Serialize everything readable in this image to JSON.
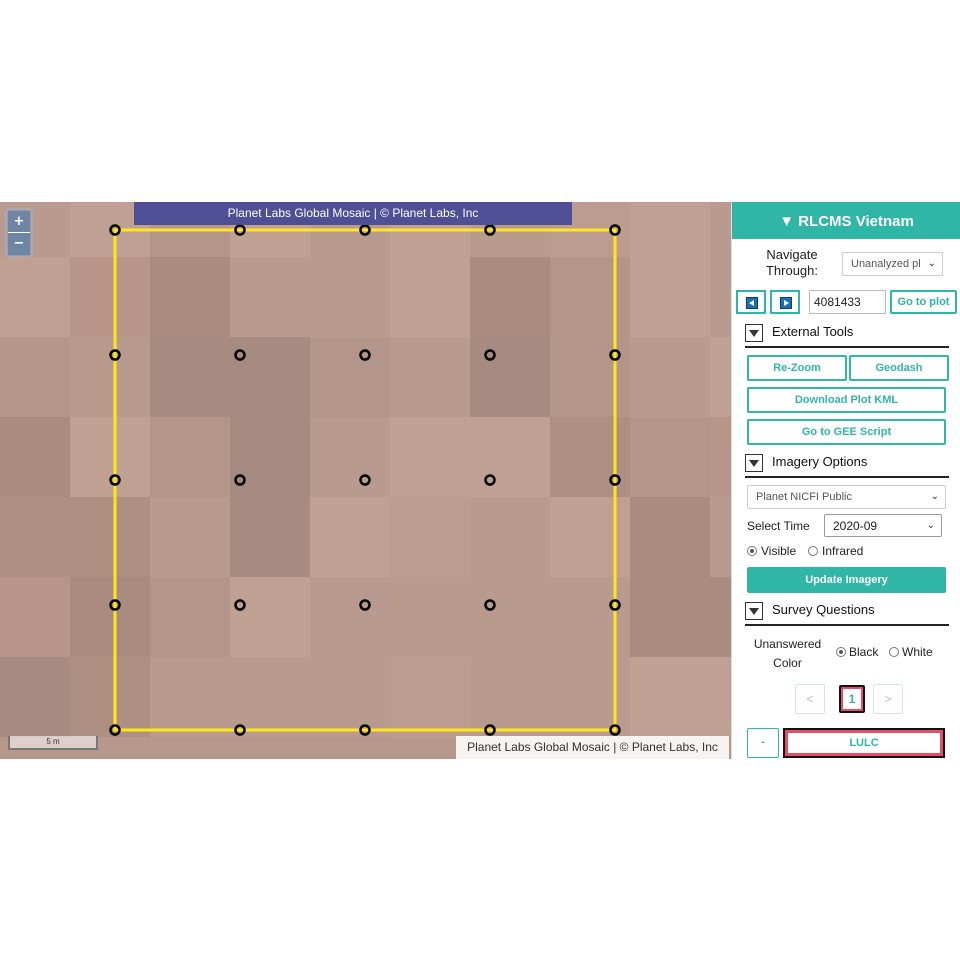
{
  "map": {
    "imagery_banner": "Planet Labs Global Mosaic | © Planet Labs, Inc",
    "attribution": "Planet Labs Global Mosaic | © Planet Labs, Inc",
    "zoom_in": "+",
    "zoom_out": "−",
    "scale_label": "5 m",
    "plot_boundary_color": "#ffe619",
    "sample_point_grid": {
      "rows": 5,
      "cols": 5
    }
  },
  "sidebar": {
    "project_title": "▼ RLCMS Vietnam",
    "navigate_label": "Navigate Through:",
    "navigate_select": "Unanalyzed pl",
    "plot_id": "4081433",
    "go_to_plot": "Go to plot",
    "external_tools": {
      "title": "External Tools",
      "rezoom": "Re-Zoom",
      "geodash": "Geodash",
      "download_kml": "Download Plot KML",
      "gee_script": "Go to GEE Script"
    },
    "imagery_options": {
      "title": "Imagery Options",
      "source": "Planet NICFI Public",
      "select_time_label": "Select Time",
      "select_time_value": "2020-09",
      "visible": "Visible",
      "infrared": "Infrared",
      "update": "Update Imagery"
    },
    "survey": {
      "title": "Survey Questions",
      "unanswered_label": "Unanswered Color",
      "black": "Black",
      "white": "White",
      "prev": "<",
      "page": "1",
      "next": ">",
      "minus": "-",
      "question": "LULC"
    }
  },
  "colors": {
    "accent": "#2fb6a6",
    "banner": "#4e4f95",
    "highlight": "#e64d6b"
  }
}
